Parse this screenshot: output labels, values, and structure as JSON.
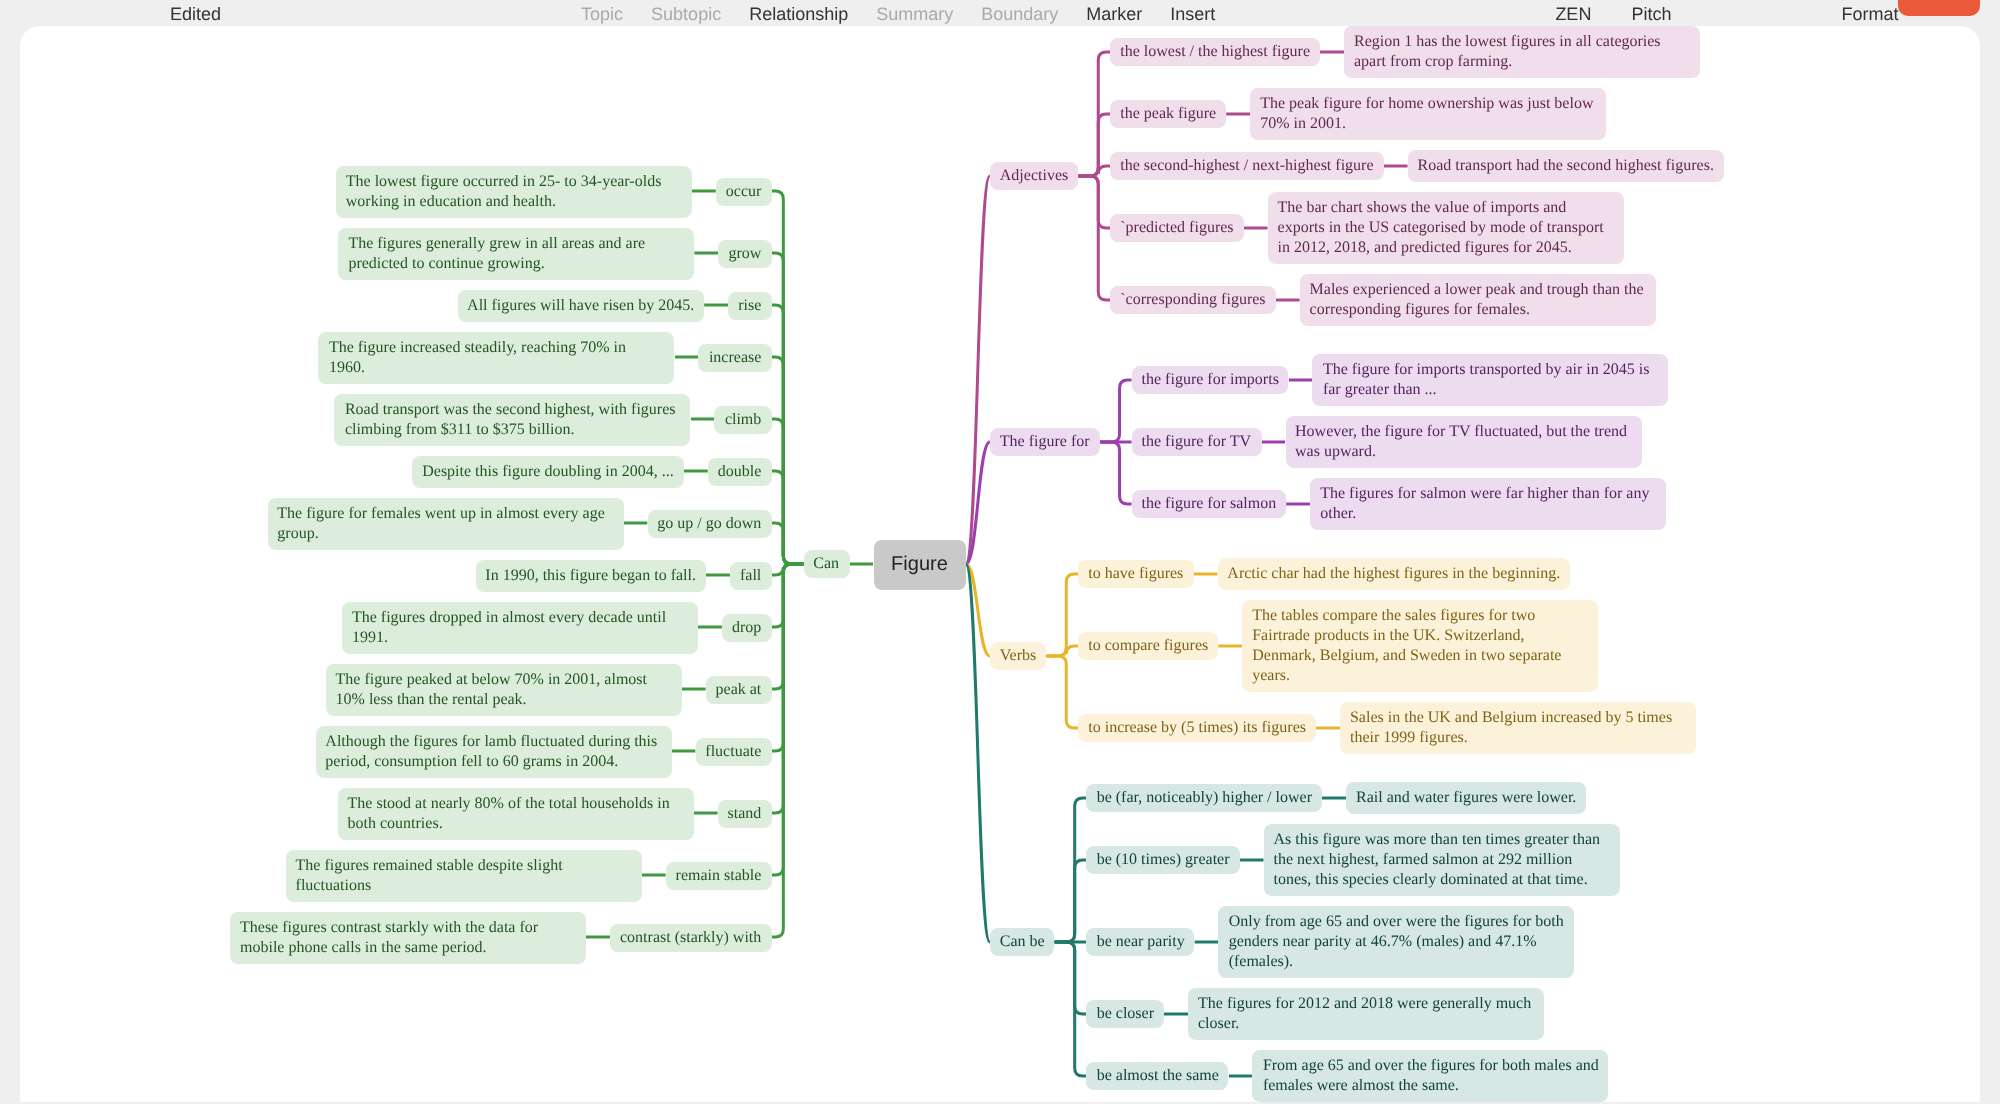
{
  "toolbar": {
    "status": "Edited",
    "items": [
      {
        "label": "Topic",
        "disabled": true
      },
      {
        "label": "Subtopic",
        "disabled": true
      },
      {
        "label": "Relationship",
        "disabled": false
      },
      {
        "label": "Summary",
        "disabled": true
      },
      {
        "label": "Boundary",
        "disabled": true
      },
      {
        "label": "Marker",
        "disabled": false
      },
      {
        "label": "Insert",
        "disabled": false
      }
    ],
    "modes": [
      {
        "label": "ZEN"
      },
      {
        "label": "Pitch"
      }
    ],
    "format": "Format"
  },
  "mindmap": {
    "root": "Figure",
    "branches": [
      {
        "label": "Can",
        "kind": "left",
        "color": "#3f9a3f",
        "children": [
          {
            "label": "occur",
            "children": [
              {
                "label": "The lowest figure occurred in 25- to 34-year-olds working in education and health."
              }
            ]
          },
          {
            "label": "grow",
            "children": [
              {
                "label": "The figures generally grew in all areas and are predicted to continue growing."
              }
            ]
          },
          {
            "label": "rise",
            "children": [
              {
                "label": "All figures will have risen by 2045."
              }
            ]
          },
          {
            "label": "increase",
            "children": [
              {
                "label": "The figure increased steadily, reaching 70% in 1960."
              }
            ]
          },
          {
            "label": "climb",
            "children": [
              {
                "label": "Road transport was the second highest, with figures climbing from $311 to $375 billion."
              }
            ]
          },
          {
            "label": "double",
            "children": [
              {
                "label": "Despite this figure doubling in 2004, ..."
              }
            ]
          },
          {
            "label": "go up / go down",
            "children": [
              {
                "label": "The figure for females went up in almost every age group."
              }
            ]
          },
          {
            "label": "fall",
            "children": [
              {
                "label": "In 1990, this figure began to fall."
              }
            ]
          },
          {
            "label": "drop",
            "children": [
              {
                "label": "The figures dropped in almost every decade until 1991."
              }
            ]
          },
          {
            "label": "peak at",
            "children": [
              {
                "label": "The figure peaked at below 70% in 2001, almost 10% less than the rental peak."
              }
            ]
          },
          {
            "label": "fluctuate",
            "children": [
              {
                "label": "Although the figures for lamb fluctuated during this period, consumption fell to 60 grams in 2004."
              }
            ]
          },
          {
            "label": "stand",
            "children": [
              {
                "label": "The stood at nearly 80% of the total households in both countries."
              }
            ]
          },
          {
            "label": "remain stable",
            "children": [
              {
                "label": "The figures remained stable despite slight fluctuations"
              }
            ]
          },
          {
            "label": "contrast (starkly) with",
            "children": [
              {
                "label": "These figures contrast starkly with the data for mobile phone calls in the same period."
              }
            ]
          }
        ]
      },
      {
        "label": "Adjectives",
        "kind": "right",
        "color": "#b04a8e",
        "children": [
          {
            "label": "the lowest / the highest figure",
            "children": [
              {
                "label": "Region 1 has the lowest figures in all categories apart from crop farming."
              }
            ]
          },
          {
            "label": "the peak figure",
            "children": [
              {
                "label": "The peak figure for home ownership was just below 70% in 2001."
              }
            ]
          },
          {
            "label": "the second-highest / next-highest figure",
            "children": [
              {
                "label": "Road transport had the second highest figures."
              }
            ]
          },
          {
            "label": "`predicted figures",
            "children": [
              {
                "label": "The bar chart shows the value of imports and exports in the US categorised by mode of transport in 2012, 2018, and predicted figures for 2045."
              }
            ]
          },
          {
            "label": "`corresponding figures",
            "children": [
              {
                "label": "Males experienced a lower peak and trough than the corresponding figures for females."
              }
            ]
          }
        ]
      },
      {
        "label": "The figure for",
        "kind": "right",
        "color": "#9b3fae",
        "children": [
          {
            "label": "the figure for imports",
            "children": [
              {
                "label": "The figure for imports transported by air in 2045 is far greater than ..."
              }
            ]
          },
          {
            "label": "the figure for TV",
            "children": [
              {
                "label": "However, the figure for TV fluctuated, but the trend was upward."
              }
            ]
          },
          {
            "label": "the figure for salmon",
            "children": [
              {
                "label": "The figures for salmon were far higher than for any other."
              }
            ]
          }
        ]
      },
      {
        "label": "Verbs",
        "kind": "right",
        "color": "#e6b52c",
        "children": [
          {
            "label": "to have figures",
            "children": [
              {
                "label": "Arctic char had the highest figures in the beginning."
              }
            ]
          },
          {
            "label": "to compare figures",
            "children": [
              {
                "label": "The tables compare the sales figures for two Fairtrade products in the UK. Switzerland, Denmark, Belgium, and Sweden in two separate years."
              }
            ]
          },
          {
            "label": "to increase by (5 times) its figures",
            "children": [
              {
                "label": "Sales in the UK and Belgium increased by 5 times their 1999 figures."
              }
            ]
          }
        ]
      },
      {
        "label": "Can be",
        "kind": "right",
        "color": "#1f7a6a",
        "children": [
          {
            "label": "be (far, noticeably) higher / lower",
            "children": [
              {
                "label": "Rail and water figures were lower."
              }
            ]
          },
          {
            "label": "be (10 times) greater",
            "children": [
              {
                "label": "As this figure was more than ten times greater than the next highest, farmed salmon at 292 million tones, this species clearly dominated at that time."
              }
            ]
          },
          {
            "label": "be near parity",
            "children": [
              {
                "label": "Only from age 65 and over were the figures for both genders near parity at 46.7% (males) and 47.1% (females)."
              }
            ]
          },
          {
            "label": "be closer",
            "children": [
              {
                "label": "The figures for 2012 and 2018 were generally much closer."
              }
            ]
          },
          {
            "label": "be almost the same",
            "children": [
              {
                "label": "From age 65 and over the figures for both males and females were almost the same."
              }
            ]
          }
        ]
      }
    ]
  }
}
